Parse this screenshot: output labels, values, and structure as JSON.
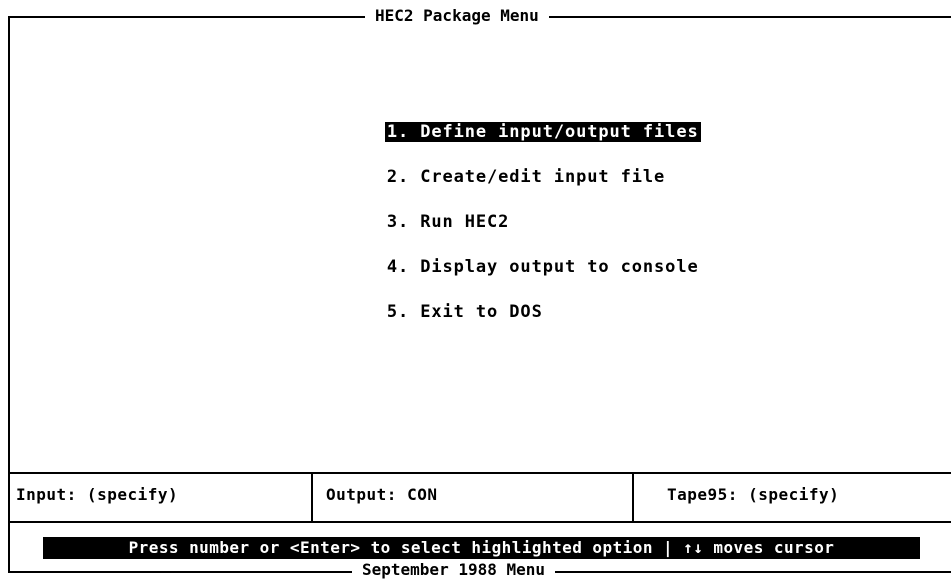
{
  "window": {
    "title": "HEC2 Package Menu",
    "footer": "September 1988 Menu"
  },
  "menu": {
    "items": [
      {
        "label": "1. Define input/output files",
        "selected": true
      },
      {
        "label": "2. Create/edit input file",
        "selected": false
      },
      {
        "label": "3. Run HEC2",
        "selected": false
      },
      {
        "label": "4. Display output to console",
        "selected": false
      },
      {
        "label": "5. Exit to DOS",
        "selected": false
      }
    ]
  },
  "status": {
    "input": "Input: (specify)",
    "output": "Output: CON",
    "tape": "Tape95: (specify)"
  },
  "hint": "Press number or <Enter> to select highlighted option | ↑↓ moves cursor",
  "colors": {
    "background": "#ffffff",
    "foreground": "#000000",
    "highlight_bg": "#000000",
    "highlight_fg": "#ffffff"
  }
}
